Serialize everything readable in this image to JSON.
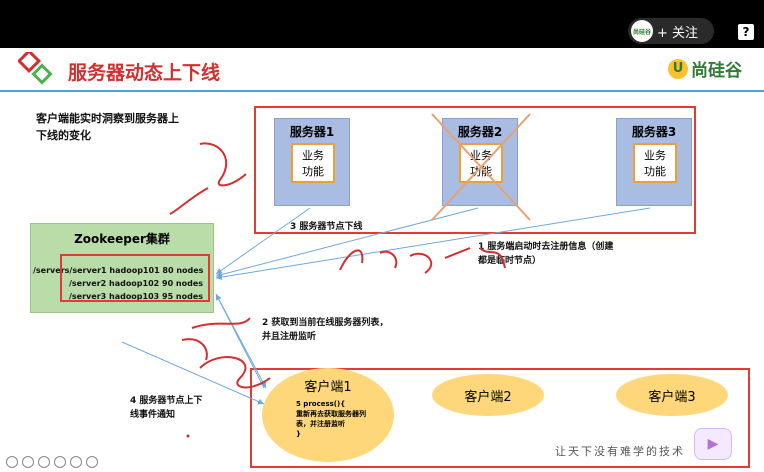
{
  "topbar": {
    "follow_label": "+ 关注",
    "avatar_text": "尚硅谷",
    "help_label": "?"
  },
  "slide": {
    "title": "服务器动态上下线",
    "brand": "尚硅谷",
    "brand_mark": "U",
    "description": "客户端能实时洞察到服务器上下线的变化",
    "servers": [
      {
        "name": "服务器1",
        "biz": "业务\n功能"
      },
      {
        "name": "服务器2",
        "biz": "业务\n功能"
      },
      {
        "name": "服务器3",
        "biz": "业务\n功能"
      }
    ],
    "zookeeper": {
      "title": "Zookeeper集群",
      "rows": [
        "/servers/server1  hadoop101  80 nodes",
        "/server2 hadoop102  90 nodes",
        "/server3 hadoop103  95 nodes"
      ]
    },
    "notes": {
      "n1": "1  服务端启动时去注册信息（创建都是临时节点）",
      "n2": "2  获取到当前在线服务器列表，并且注册监听",
      "n3": "3 服务器节点下线",
      "n4": "4  服务器节点上下线事件通知"
    },
    "clients": [
      {
        "name": "客户端1",
        "detail": "5 process(){\n重新再去获取服务器列表，并注册监听\n}"
      },
      {
        "name": "客户端2"
      },
      {
        "name": "客户端3"
      }
    ],
    "handwriting": {
      "create": "create",
      "get": "get",
      "w": "-w"
    },
    "watermark": "让天下没有难学的技术"
  },
  "colors": {
    "title": "#d32f2f",
    "accent_line": "#4aa3df",
    "red_box": "#e53935",
    "server_fill": "#a9bde3",
    "zk_fill": "#b9dca8",
    "client_fill": "#fdd77a"
  }
}
